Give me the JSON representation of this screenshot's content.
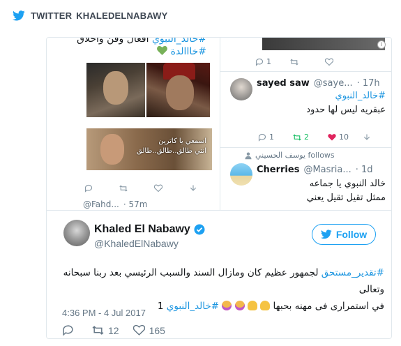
{
  "header": {
    "source": "TWITTER",
    "account": "KHALEDELNABAWY"
  },
  "collage": {
    "left_tweet": {
      "line1_hash": "#خالد_النبوي",
      "line1_text": "أفعال وفن وأخلاق",
      "line2_hash": "#خااالدة",
      "photo_caption_line1": "اسمعي يا كاترين",
      "photo_caption_line2": "انتي طالق..طالق..طالق",
      "actions": {
        "reply": "",
        "retweet": "",
        "like": ""
      }
    },
    "right_top": {
      "info": "i",
      "actions": {
        "reply": "1",
        "retweet": "",
        "like": ""
      }
    },
    "sayed": {
      "name": "sayed saw",
      "handle": "@saye...",
      "time": "· 17h",
      "hash": "#خالد_النبوي",
      "text": "عبقريه ليس لها حدود",
      "actions": {
        "reply": "1",
        "retweet": "2",
        "like": "10"
      }
    },
    "cherries": {
      "follows_label": "يوسف الحسيني follows",
      "name": "Cherries",
      "handle": "@Masria...",
      "time": "· 1d",
      "line1": "خالد النبوي يا جماعه",
      "line2": "ممثل تقيل تقيل يعني"
    },
    "fahd": {
      "handle": "@Fahd...",
      "time": "· 57m"
    }
  },
  "main_tweet": {
    "name": "Khaled El Nabawy",
    "handle": "@KhaledElNabawy",
    "follow_label": "Follow",
    "hash1": "#تقدير_مستحق",
    "text1": " لجمهور عظيم كان ومازال السند والسبب الرئيسي بعد ربنا سبحانه وتعالى",
    "text2": "في استمرارى فى مهنه بحبها",
    "hash2": "#خالد_النبوي",
    "number": "1",
    "timestamp": "4:36 PM - 4 Jul 2017",
    "reply_count": "",
    "retweet_count": "12",
    "like_count": "165"
  },
  "colors": {
    "link": "#1b95e0",
    "follow": "#1da1f2",
    "retweet_active": "#17bf63",
    "like_active": "#e0245e",
    "muted": "#657786"
  }
}
